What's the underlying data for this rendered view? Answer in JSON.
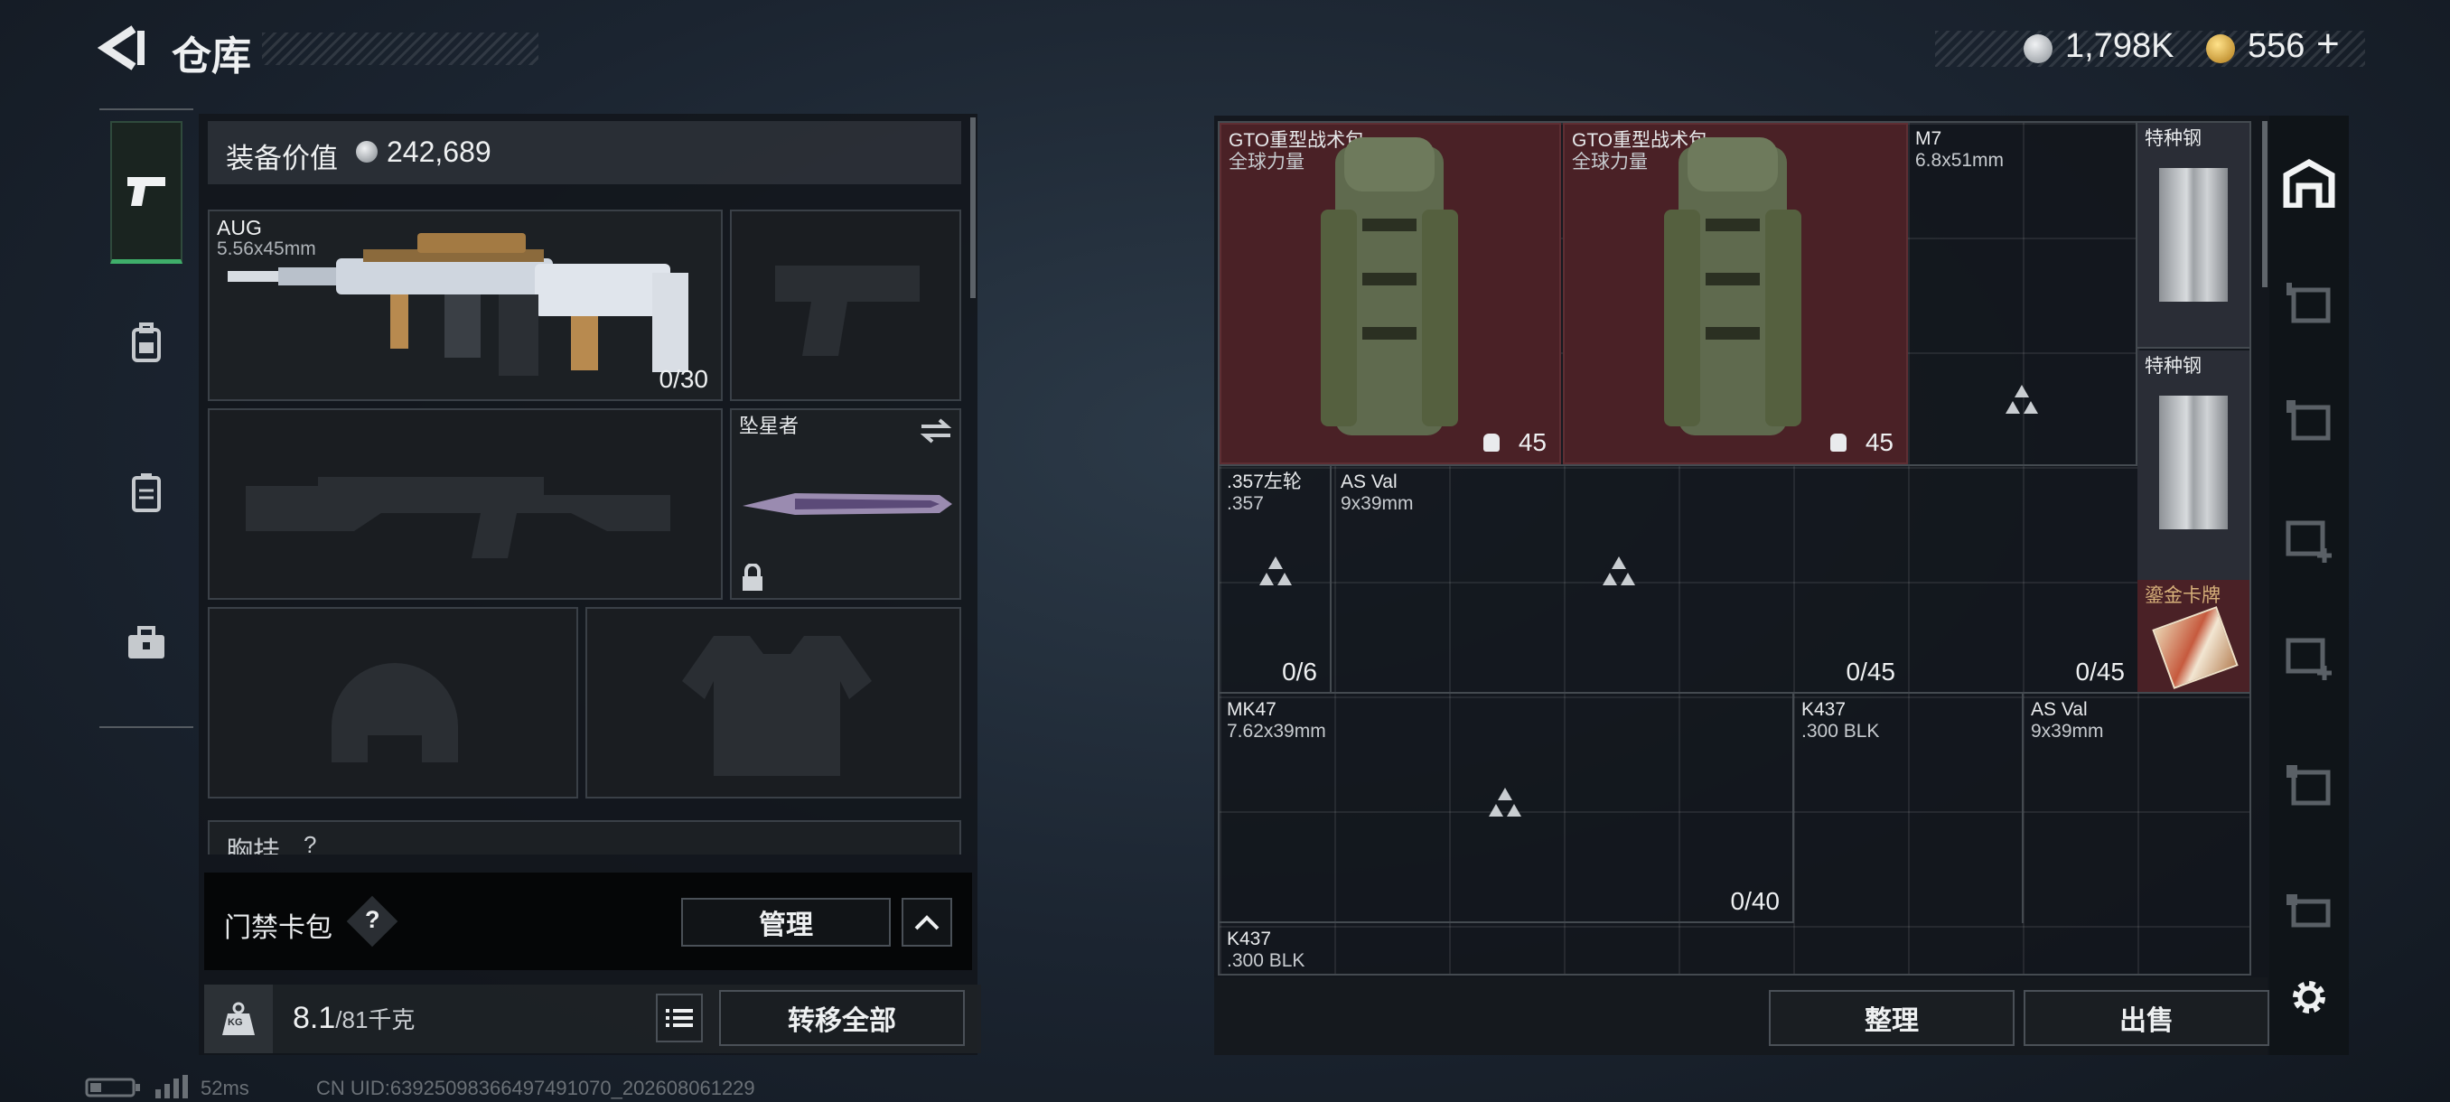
{
  "header": {
    "title": "仓库",
    "currency_silver": "1,798K",
    "currency_gold": "556",
    "gold_plus": "+"
  },
  "loadout": {
    "value_label": "装备价值",
    "value": "242,689",
    "primary": {
      "name": "AUG",
      "caliber": "5.56x45mm",
      "ammo": "0/30"
    },
    "melee": {
      "name": "坠星者"
    },
    "chest_rig_label": "胸挂",
    "chest_rig_help": "?",
    "keycard": {
      "label": "门禁卡包",
      "help": "?",
      "manage": "管理"
    },
    "weight_value": "8.1",
    "weight_max": "/81千克",
    "weight_icon_text": "KG",
    "transfer_all": "转移全部"
  },
  "stash": {
    "items": [
      {
        "name": "GTO重型战术包",
        "sub": "全球力量",
        "count": "45"
      },
      {
        "name": "GTO重型战术包",
        "sub": "全球力量",
        "count": "45"
      },
      {
        "name": "M7",
        "sub": "6.8x51mm"
      },
      {
        "name": "特种钢",
        "sub": ""
      },
      {
        "name": "特种钢",
        "sub": ""
      },
      {
        "name": "鎏金卡牌",
        "sub": ""
      },
      {
        "name": ".357左轮",
        "sub": ".357",
        "count": "0/6"
      },
      {
        "name": "AS Val",
        "sub": "9x39mm",
        "count": "0/45"
      },
      {
        "name": "",
        "sub": "",
        "count": "0/45"
      },
      {
        "name": "MK47",
        "sub": "7.62x39mm",
        "count": "0/40"
      },
      {
        "name": "K437",
        "sub": ".300 BLK"
      },
      {
        "name": "AS Val",
        "sub": "9x39mm"
      },
      {
        "name": "K437",
        "sub": ".300 BLK"
      }
    ],
    "sort_button": "整理",
    "sell_button": "出售"
  },
  "status": {
    "ping": "52ms",
    "uid": "CN UID:63925098366497491070_202608061229"
  },
  "colors": {
    "accent_green": "#3fae6a",
    "backpack_bg": "#4a2126",
    "item_bg": "#2a2d33"
  }
}
